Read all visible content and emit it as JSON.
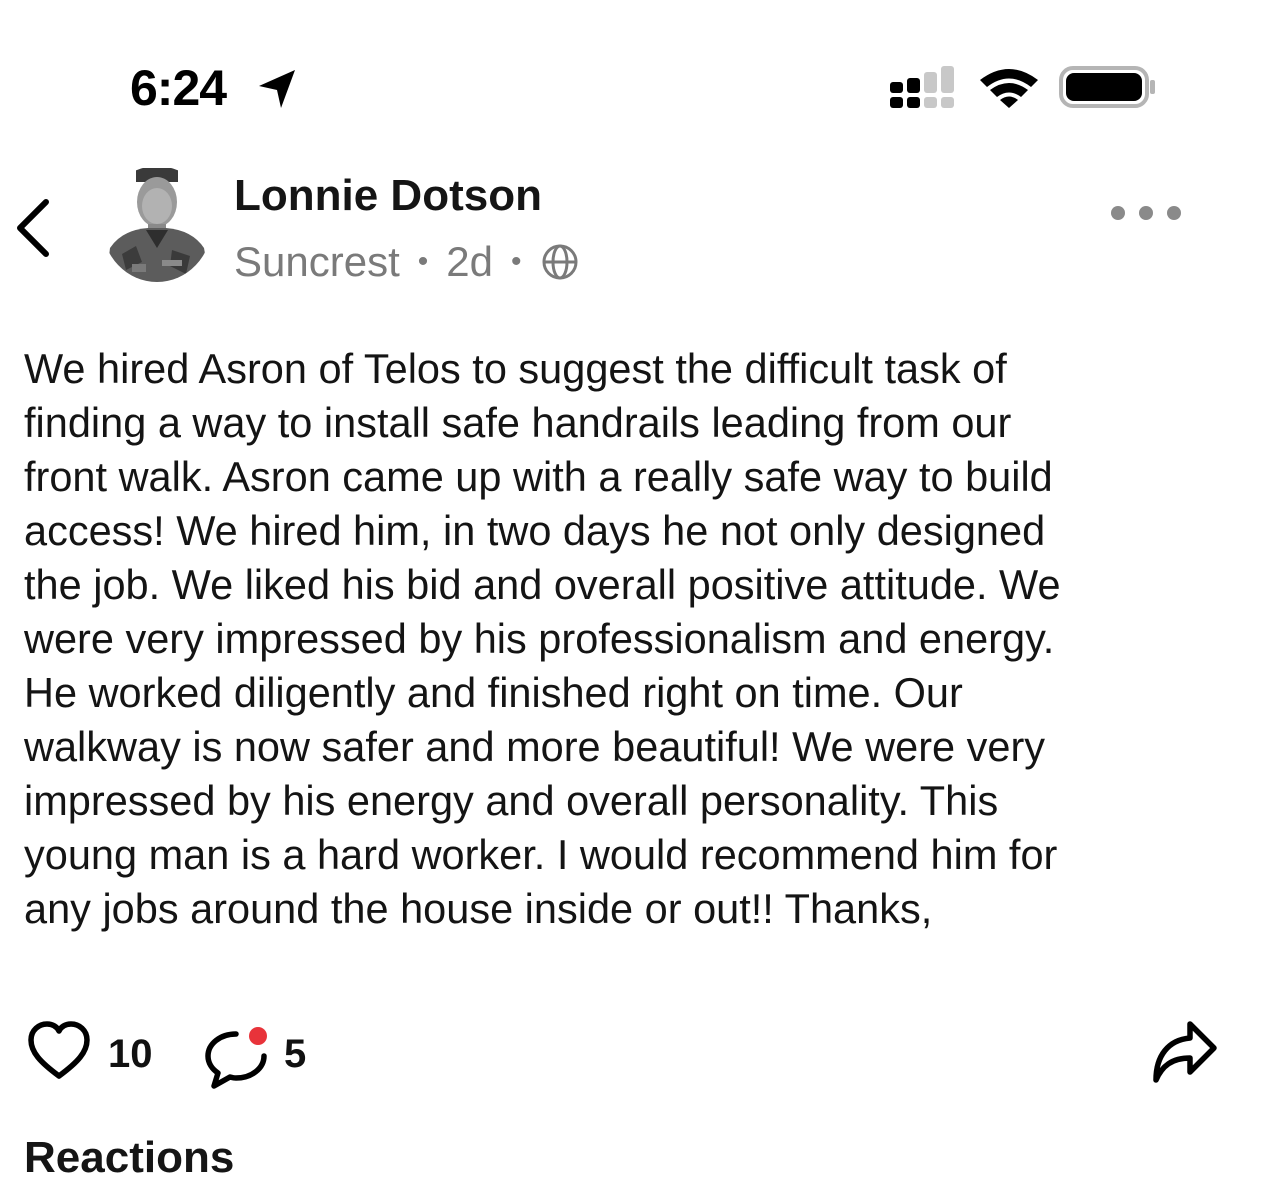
{
  "status_bar": {
    "time": "6:24",
    "icons": [
      "location-arrow-icon",
      "cellular-signal-icon",
      "wifi-icon",
      "battery-icon"
    ]
  },
  "post": {
    "author_name": "Lonnie Dotson",
    "neighborhood": "Suncrest",
    "age": "2d",
    "visibility_icon": "globe-icon",
    "body": "We hired Asron of Telos to suggest the difficult task of\nfinding a way to install safe handrails leading from our\nfront walk. Asron came up with a really safe way to build\naccess! We hired him, in two days he not only designed\nthe job. We liked his bid and overall positive attitude. We\nwere very impressed by his professionalism and energy.\nHe worked diligently and finished right on time. Our\nwalkway is now safer and more beautiful! We were very\nimpressed by his energy and overall personality. This\nyoung man is a hard worker. I would recommend him for\nany jobs around the house inside or out!! Thanks,"
  },
  "actions": {
    "like_count": "10",
    "comment_count": "5",
    "icons": [
      "heart-icon",
      "comment-icon",
      "share-icon"
    ],
    "unread_dot_color": "#e8333a"
  },
  "reactions": {
    "heading": "Reactions"
  },
  "colors": {
    "text_primary": "#141414",
    "text_secondary": "#7a7a7a",
    "background": "#ffffff"
  }
}
